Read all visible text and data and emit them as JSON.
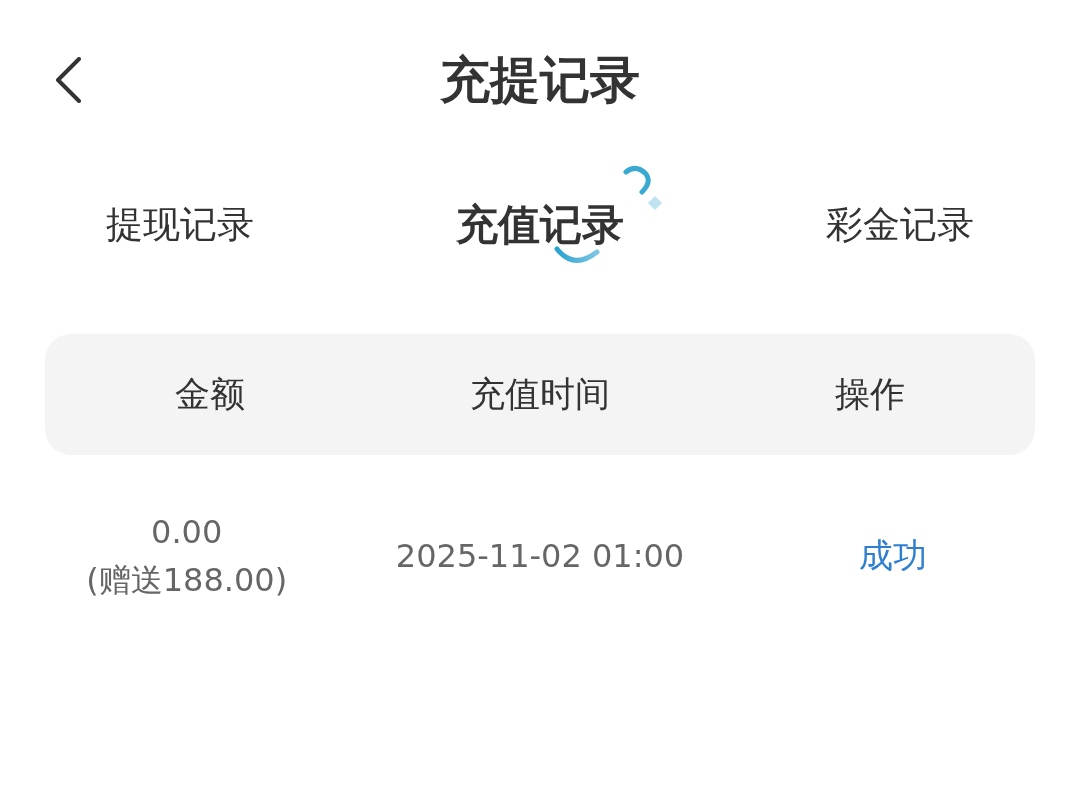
{
  "header": {
    "title": "充提记录"
  },
  "tabs": [
    {
      "label": "提现记录",
      "selected": false
    },
    {
      "label": "充值记录",
      "selected": true
    },
    {
      "label": "彩金记录",
      "selected": false
    }
  ],
  "table": {
    "columns": [
      "金额",
      "充值时间",
      "操作"
    ],
    "rows": [
      {
        "amount": "0.00",
        "bonus": "(赠送188.00)",
        "time": "2025-11-02 01:00",
        "status": "成功"
      }
    ]
  }
}
